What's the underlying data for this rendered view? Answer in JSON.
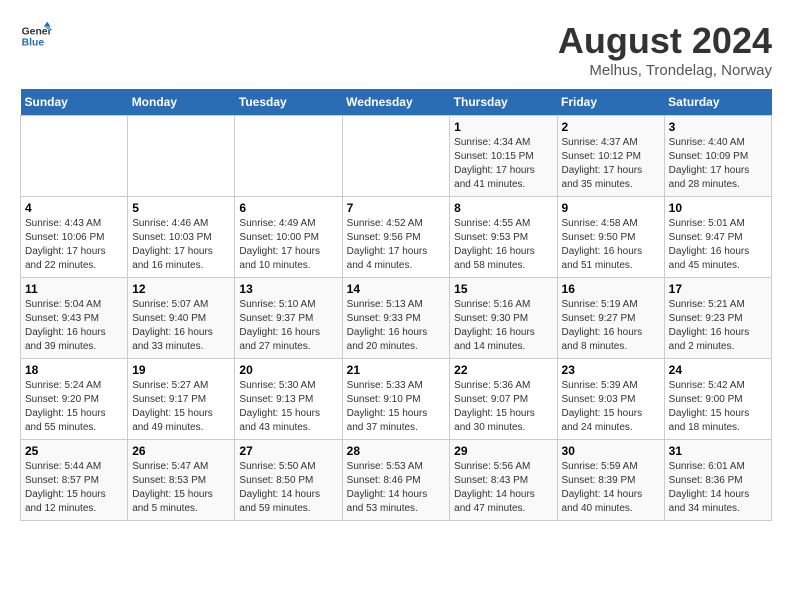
{
  "header": {
    "logo_general": "General",
    "logo_blue": "Blue",
    "month_year": "August 2024",
    "location": "Melhus, Trondelag, Norway"
  },
  "days_of_week": [
    "Sunday",
    "Monday",
    "Tuesday",
    "Wednesday",
    "Thursday",
    "Friday",
    "Saturday"
  ],
  "weeks": [
    [
      {
        "day": "",
        "sunrise": "",
        "sunset": "",
        "daylight": ""
      },
      {
        "day": "",
        "sunrise": "",
        "sunset": "",
        "daylight": ""
      },
      {
        "day": "",
        "sunrise": "",
        "sunset": "",
        "daylight": ""
      },
      {
        "day": "",
        "sunrise": "",
        "sunset": "",
        "daylight": ""
      },
      {
        "day": "1",
        "sunrise": "Sunrise: 4:34 AM",
        "sunset": "Sunset: 10:15 PM",
        "daylight": "Daylight: 17 hours and 41 minutes."
      },
      {
        "day": "2",
        "sunrise": "Sunrise: 4:37 AM",
        "sunset": "Sunset: 10:12 PM",
        "daylight": "Daylight: 17 hours and 35 minutes."
      },
      {
        "day": "3",
        "sunrise": "Sunrise: 4:40 AM",
        "sunset": "Sunset: 10:09 PM",
        "daylight": "Daylight: 17 hours and 28 minutes."
      }
    ],
    [
      {
        "day": "4",
        "sunrise": "Sunrise: 4:43 AM",
        "sunset": "Sunset: 10:06 PM",
        "daylight": "Daylight: 17 hours and 22 minutes."
      },
      {
        "day": "5",
        "sunrise": "Sunrise: 4:46 AM",
        "sunset": "Sunset: 10:03 PM",
        "daylight": "Daylight: 17 hours and 16 minutes."
      },
      {
        "day": "6",
        "sunrise": "Sunrise: 4:49 AM",
        "sunset": "Sunset: 10:00 PM",
        "daylight": "Daylight: 17 hours and 10 minutes."
      },
      {
        "day": "7",
        "sunrise": "Sunrise: 4:52 AM",
        "sunset": "Sunset: 9:56 PM",
        "daylight": "Daylight: 17 hours and 4 minutes."
      },
      {
        "day": "8",
        "sunrise": "Sunrise: 4:55 AM",
        "sunset": "Sunset: 9:53 PM",
        "daylight": "Daylight: 16 hours and 58 minutes."
      },
      {
        "day": "9",
        "sunrise": "Sunrise: 4:58 AM",
        "sunset": "Sunset: 9:50 PM",
        "daylight": "Daylight: 16 hours and 51 minutes."
      },
      {
        "day": "10",
        "sunrise": "Sunrise: 5:01 AM",
        "sunset": "Sunset: 9:47 PM",
        "daylight": "Daylight: 16 hours and 45 minutes."
      }
    ],
    [
      {
        "day": "11",
        "sunrise": "Sunrise: 5:04 AM",
        "sunset": "Sunset: 9:43 PM",
        "daylight": "Daylight: 16 hours and 39 minutes."
      },
      {
        "day": "12",
        "sunrise": "Sunrise: 5:07 AM",
        "sunset": "Sunset: 9:40 PM",
        "daylight": "Daylight: 16 hours and 33 minutes."
      },
      {
        "day": "13",
        "sunrise": "Sunrise: 5:10 AM",
        "sunset": "Sunset: 9:37 PM",
        "daylight": "Daylight: 16 hours and 27 minutes."
      },
      {
        "day": "14",
        "sunrise": "Sunrise: 5:13 AM",
        "sunset": "Sunset: 9:33 PM",
        "daylight": "Daylight: 16 hours and 20 minutes."
      },
      {
        "day": "15",
        "sunrise": "Sunrise: 5:16 AM",
        "sunset": "Sunset: 9:30 PM",
        "daylight": "Daylight: 16 hours and 14 minutes."
      },
      {
        "day": "16",
        "sunrise": "Sunrise: 5:19 AM",
        "sunset": "Sunset: 9:27 PM",
        "daylight": "Daylight: 16 hours and 8 minutes."
      },
      {
        "day": "17",
        "sunrise": "Sunrise: 5:21 AM",
        "sunset": "Sunset: 9:23 PM",
        "daylight": "Daylight: 16 hours and 2 minutes."
      }
    ],
    [
      {
        "day": "18",
        "sunrise": "Sunrise: 5:24 AM",
        "sunset": "Sunset: 9:20 PM",
        "daylight": "Daylight: 15 hours and 55 minutes."
      },
      {
        "day": "19",
        "sunrise": "Sunrise: 5:27 AM",
        "sunset": "Sunset: 9:17 PM",
        "daylight": "Daylight: 15 hours and 49 minutes."
      },
      {
        "day": "20",
        "sunrise": "Sunrise: 5:30 AM",
        "sunset": "Sunset: 9:13 PM",
        "daylight": "Daylight: 15 hours and 43 minutes."
      },
      {
        "day": "21",
        "sunrise": "Sunrise: 5:33 AM",
        "sunset": "Sunset: 9:10 PM",
        "daylight": "Daylight: 15 hours and 37 minutes."
      },
      {
        "day": "22",
        "sunrise": "Sunrise: 5:36 AM",
        "sunset": "Sunset: 9:07 PM",
        "daylight": "Daylight: 15 hours and 30 minutes."
      },
      {
        "day": "23",
        "sunrise": "Sunrise: 5:39 AM",
        "sunset": "Sunset: 9:03 PM",
        "daylight": "Daylight: 15 hours and 24 minutes."
      },
      {
        "day": "24",
        "sunrise": "Sunrise: 5:42 AM",
        "sunset": "Sunset: 9:00 PM",
        "daylight": "Daylight: 15 hours and 18 minutes."
      }
    ],
    [
      {
        "day": "25",
        "sunrise": "Sunrise: 5:44 AM",
        "sunset": "Sunset: 8:57 PM",
        "daylight": "Daylight: 15 hours and 12 minutes."
      },
      {
        "day": "26",
        "sunrise": "Sunrise: 5:47 AM",
        "sunset": "Sunset: 8:53 PM",
        "daylight": "Daylight: 15 hours and 5 minutes."
      },
      {
        "day": "27",
        "sunrise": "Sunrise: 5:50 AM",
        "sunset": "Sunset: 8:50 PM",
        "daylight": "Daylight: 14 hours and 59 minutes."
      },
      {
        "day": "28",
        "sunrise": "Sunrise: 5:53 AM",
        "sunset": "Sunset: 8:46 PM",
        "daylight": "Daylight: 14 hours and 53 minutes."
      },
      {
        "day": "29",
        "sunrise": "Sunrise: 5:56 AM",
        "sunset": "Sunset: 8:43 PM",
        "daylight": "Daylight: 14 hours and 47 minutes."
      },
      {
        "day": "30",
        "sunrise": "Sunrise: 5:59 AM",
        "sunset": "Sunset: 8:39 PM",
        "daylight": "Daylight: 14 hours and 40 minutes."
      },
      {
        "day": "31",
        "sunrise": "Sunrise: 6:01 AM",
        "sunset": "Sunset: 8:36 PM",
        "daylight": "Daylight: 14 hours and 34 minutes."
      }
    ]
  ]
}
